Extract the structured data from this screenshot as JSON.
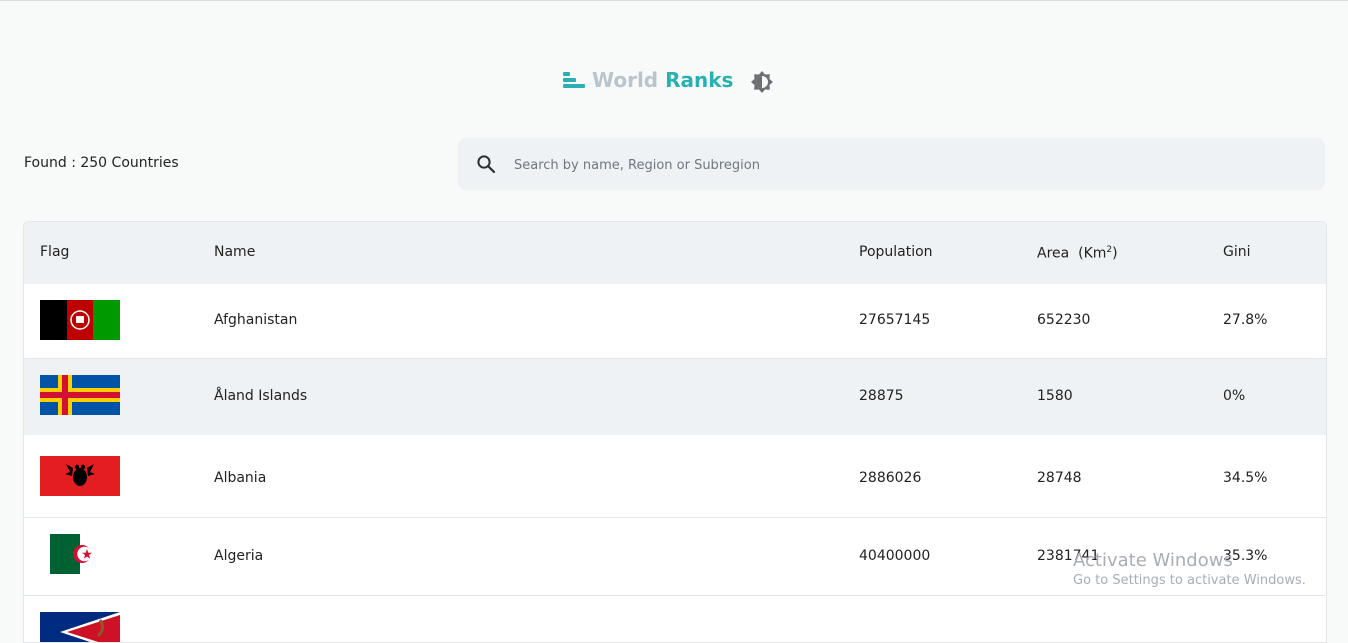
{
  "app": {
    "logo_word1": "World",
    "logo_word2": "Ranks",
    "accent_color": "#2ab0b2",
    "muted_color": "#b9c5cc",
    "theme_icon": "theme-toggle-icon"
  },
  "summary": {
    "found_text": "Found : 250 Countries"
  },
  "search": {
    "placeholder": "Search by name, Region or Subregion",
    "value": "",
    "icon": "search-icon"
  },
  "table": {
    "headers": {
      "flag": "Flag",
      "name": "Name",
      "population": "Population",
      "area": "Area  (Km",
      "area_sup": "2",
      "area_close": ")",
      "gini": "Gini"
    },
    "rows": [
      {
        "flag": "afghanistan-flag",
        "name": "Afghanistan",
        "population": "27657145",
        "area": "652230",
        "gini": "27.8%"
      },
      {
        "flag": "aland-islands-flag",
        "name": "Åland Islands",
        "population": "28875",
        "area": "1580",
        "gini": "0%"
      },
      {
        "flag": "albania-flag",
        "name": "Albania",
        "population": "2886026",
        "area": "28748",
        "gini": "34.5%"
      },
      {
        "flag": "algeria-flag",
        "name": "Algeria",
        "population": "40400000",
        "area": "2381741",
        "gini": "35.3%"
      },
      {
        "flag": "american-samoa-flag",
        "name": "",
        "population": "",
        "area": "",
        "gini": ""
      }
    ]
  },
  "watermark": {
    "title": "Activate Windows",
    "subtitle": "Go to Settings to activate Windows."
  }
}
